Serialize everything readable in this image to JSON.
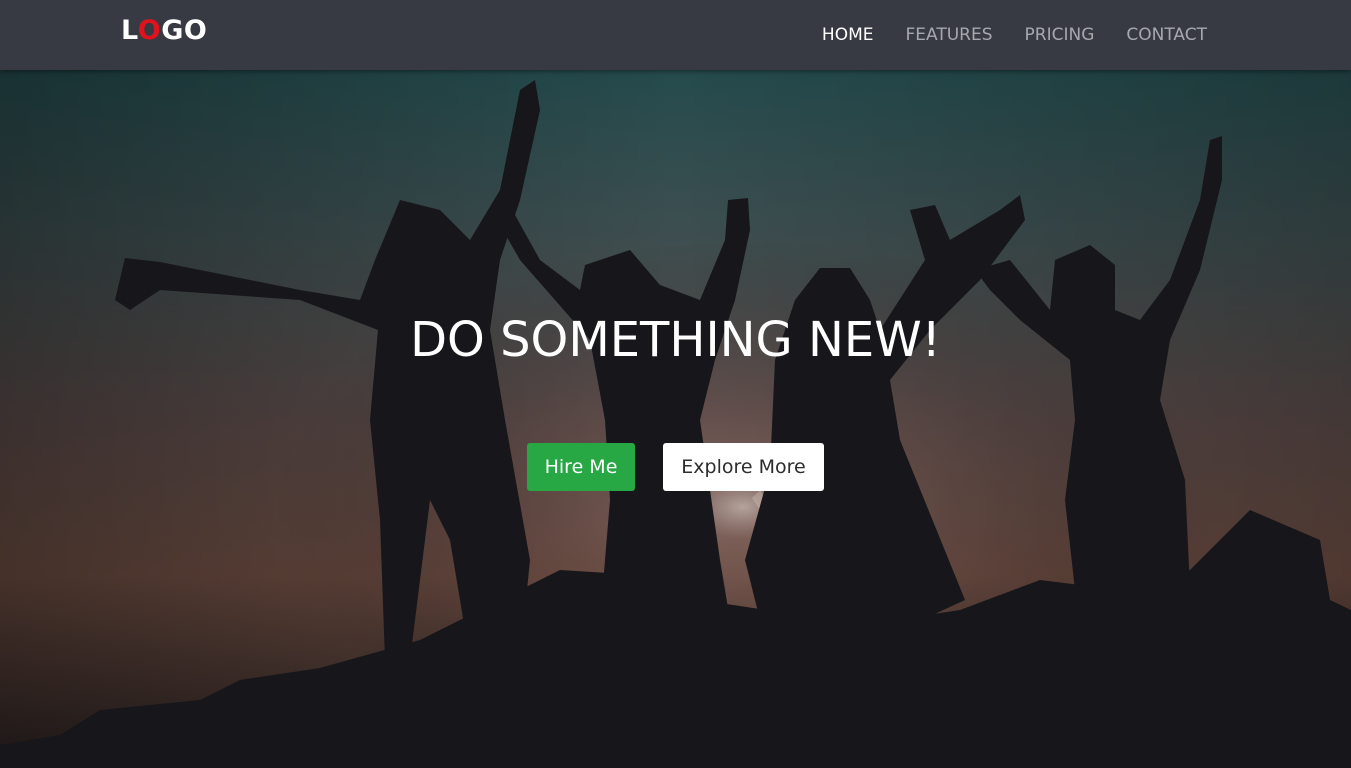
{
  "navbar": {
    "logo": {
      "first": "L",
      "accent": "O",
      "rest": "GO",
      "accent_color": "#e0131d"
    },
    "links": [
      {
        "label": "HOME",
        "active": true
      },
      {
        "label": "FEATURES",
        "active": false
      },
      {
        "label": "PRICING",
        "active": false
      },
      {
        "label": "CONTACT",
        "active": false
      }
    ]
  },
  "hero": {
    "title": "DO SOMETHING NEW!",
    "primary_button": "Hire Me",
    "secondary_button": "Explore More",
    "background_image": "silhouettes-of-people-celebrating-at-sunset"
  },
  "colors": {
    "navbar_bg": "#373a42",
    "primary": "#28a745",
    "accent": "#e0131d"
  }
}
